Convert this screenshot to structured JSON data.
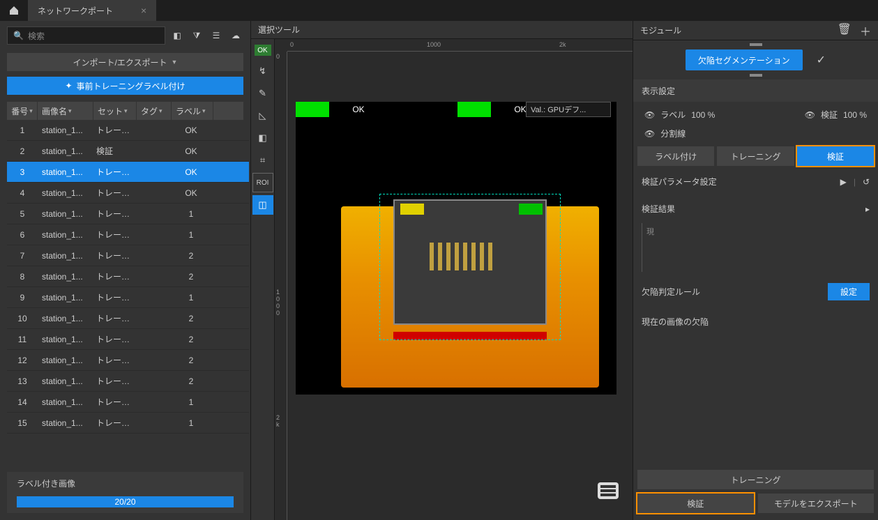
{
  "titlebar": {
    "tab_title": "ネットワークポート"
  },
  "left": {
    "search_placeholder": "検索",
    "import_export": "インポート/エクスポート",
    "pretrain_btn": "事前トレーニングラベル付け",
    "headers": {
      "num": "番号",
      "name": "画像名",
      "set": "セット",
      "tag": "タグ",
      "label": "ラベル"
    },
    "rows": [
      {
        "num": "1",
        "name": "station_1...",
        "set": "トレーニ...",
        "tag": "",
        "label": "OK"
      },
      {
        "num": "2",
        "name": "station_1...",
        "set": "検証",
        "tag": "",
        "label": "OK"
      },
      {
        "num": "3",
        "name": "station_1...",
        "set": "トレーニ...",
        "tag": "",
        "label": "OK",
        "selected": true
      },
      {
        "num": "4",
        "name": "station_1...",
        "set": "トレーニ...",
        "tag": "",
        "label": "OK"
      },
      {
        "num": "5",
        "name": "station_1...",
        "set": "トレーニ...",
        "tag": "",
        "label": "1"
      },
      {
        "num": "6",
        "name": "station_1...",
        "set": "トレーニ...",
        "tag": "",
        "label": "1"
      },
      {
        "num": "7",
        "name": "station_1...",
        "set": "トレーニ...",
        "tag": "",
        "label": "2"
      },
      {
        "num": "8",
        "name": "station_1...",
        "set": "トレーニ...",
        "tag": "",
        "label": "2"
      },
      {
        "num": "9",
        "name": "station_1...",
        "set": "トレーニ...",
        "tag": "",
        "label": "1"
      },
      {
        "num": "10",
        "name": "station_1...",
        "set": "トレーニ...",
        "tag": "",
        "label": "2"
      },
      {
        "num": "11",
        "name": "station_1...",
        "set": "トレーニ...",
        "tag": "",
        "label": "2"
      },
      {
        "num": "12",
        "name": "station_1...",
        "set": "トレーニ...",
        "tag": "",
        "label": "2"
      },
      {
        "num": "13",
        "name": "station_1...",
        "set": "トレーニ...",
        "tag": "",
        "label": "2"
      },
      {
        "num": "14",
        "name": "station_1...",
        "set": "トレーニ...",
        "tag": "",
        "label": "1"
      },
      {
        "num": "15",
        "name": "station_1...",
        "set": "トレーニ...",
        "tag": "",
        "label": "1"
      }
    ],
    "footer_label": "ラベル付き画像",
    "progress_text": "20/20"
  },
  "center": {
    "title": "選択ツール",
    "ok_badge": "OK",
    "roi_label": "ROI",
    "ruler_h": {
      "t0": "0",
      "t1000": "1000",
      "t2k": "2k"
    },
    "ruler_v": {
      "t0": "0",
      "t1000": "1\n0\n0\n0",
      "t2k": "2\nk"
    },
    "tags": {
      "ok1": "OK",
      "ok2": "OK",
      "val": "Val.:   GPUデフ..."
    }
  },
  "right": {
    "title": "モジュール",
    "module_name": "欠陥セグメンテーション",
    "display_section": "表示設定",
    "label_text": "ラベル",
    "label_pct": "100 %",
    "verify_text": "検証",
    "verify_pct": "100 %",
    "segline": "分割線",
    "tabs": {
      "labeling": "ラベル付け",
      "training": "トレーニング",
      "verify": "検証"
    },
    "param_title": "検証パラメータ設定",
    "result_title": "検証結果",
    "result_hint": "現",
    "rule_title": "欠陥判定ルール",
    "rule_btn": "設定",
    "defects_title": "現在の画像の欠陥",
    "footer": {
      "training": "トレーニング",
      "verify": "検証",
      "export": "モデルをエクスポート"
    }
  }
}
